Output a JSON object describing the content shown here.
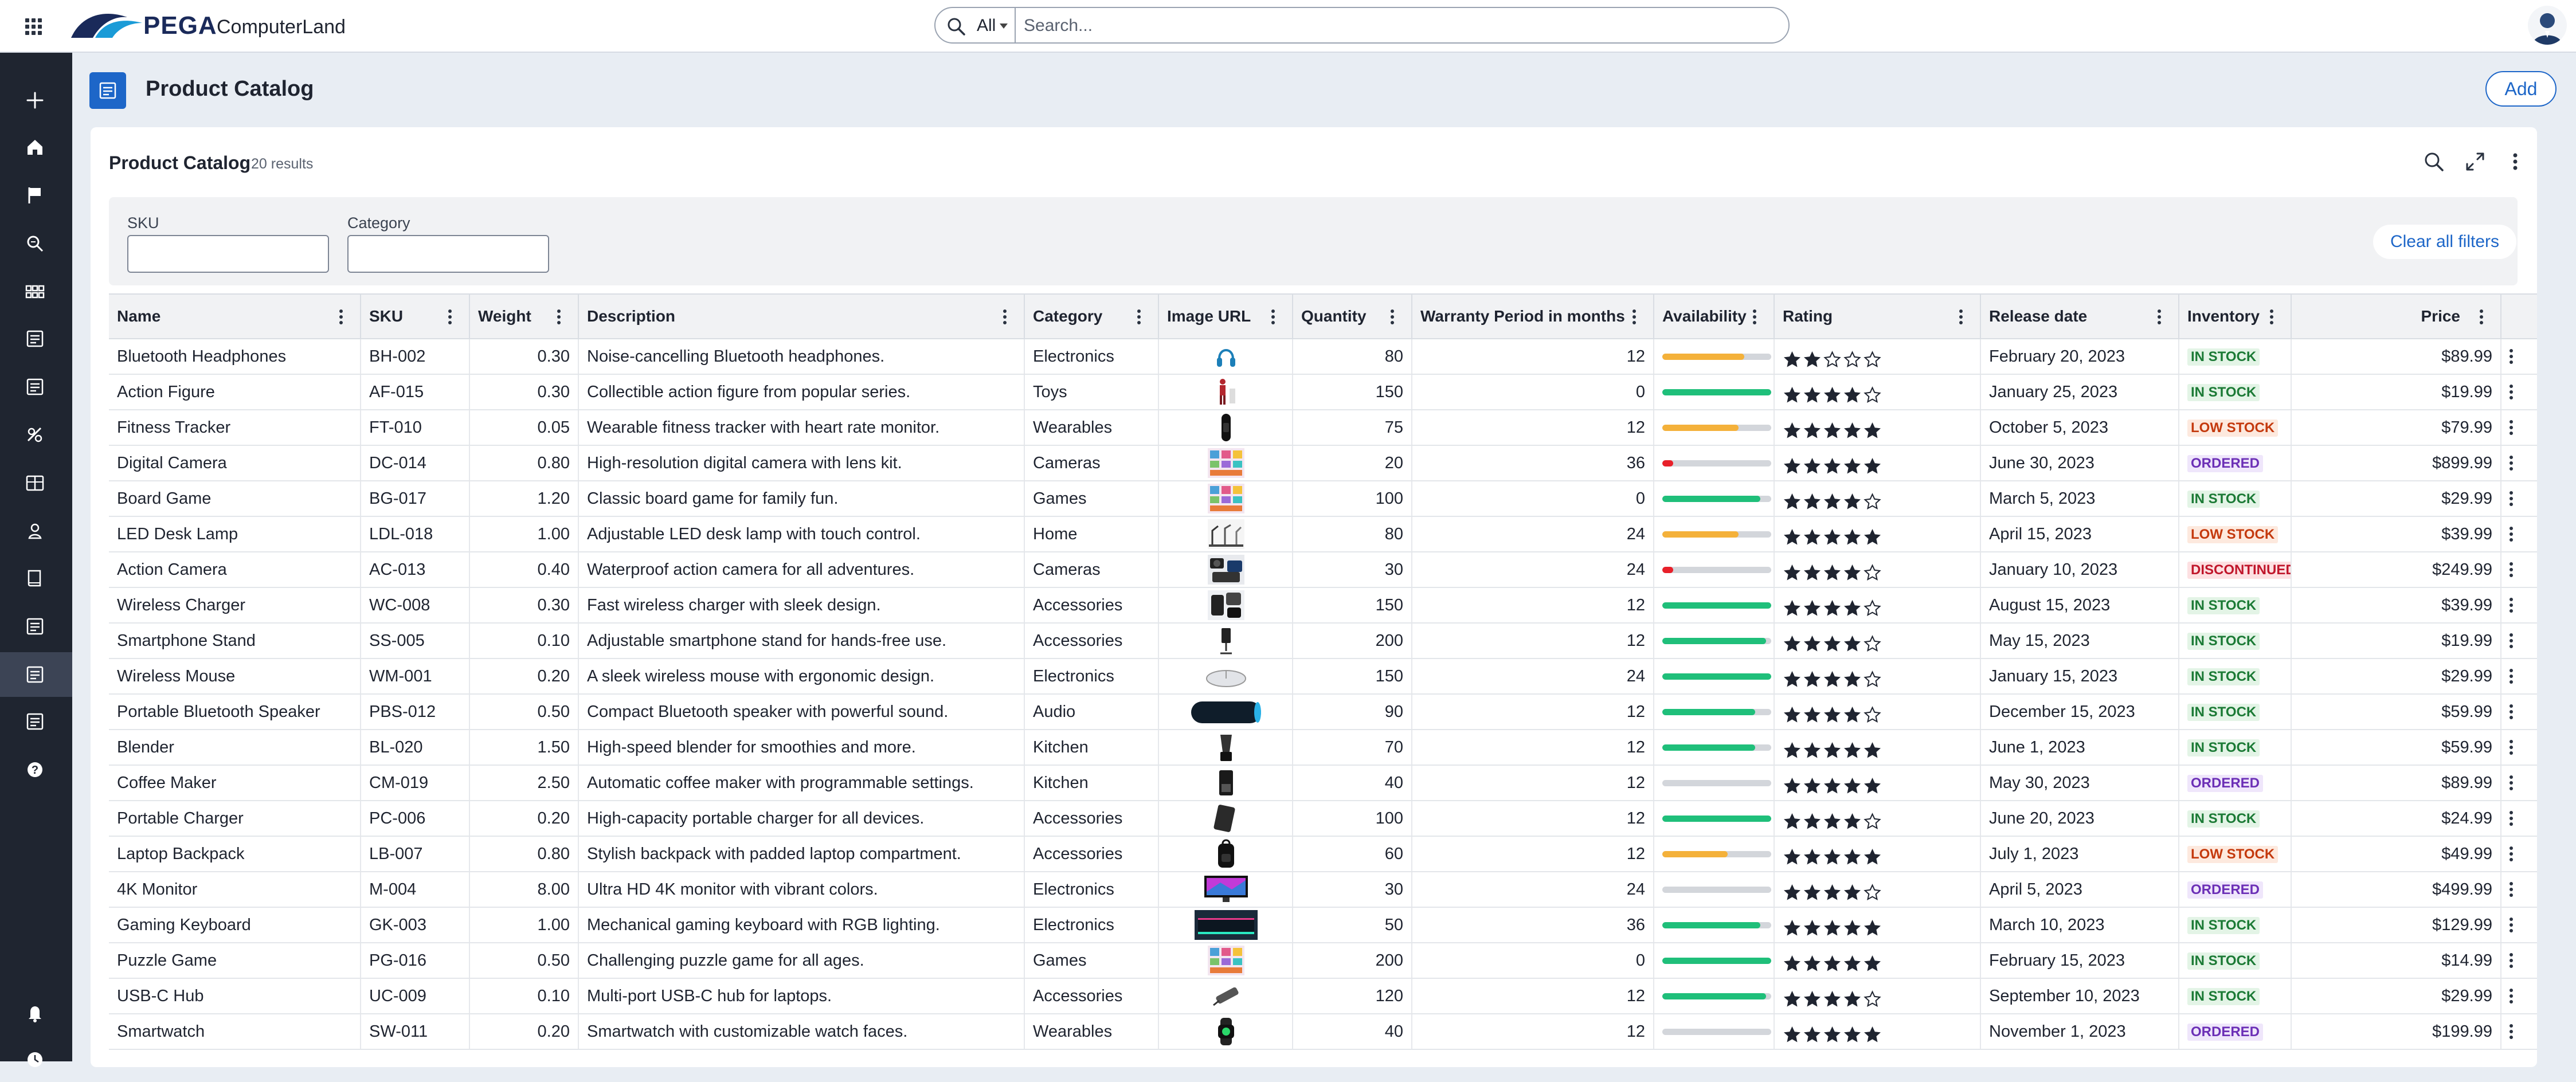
{
  "header": {
    "brand": "PEGA",
    "app_name": "ComputerLand",
    "search_scope": "All",
    "search_placeholder": "Search..."
  },
  "nav": {
    "items": [
      "add-icon",
      "home-icon",
      "flag-icon",
      "search-detail-icon",
      "apps-icon",
      "report-icon",
      "report-icon",
      "campaign-icon",
      "layout-icon",
      "tools-icon",
      "book-icon",
      "report-icon",
      "product-catalog-icon",
      "report-icon",
      "help-icon",
      "bell-icon",
      "clock-icon"
    ],
    "active_index": 12
  },
  "page": {
    "title": "Product Catalog",
    "add_label": "Add"
  },
  "list": {
    "title": "Product Catalog",
    "count": "20 results",
    "filters": {
      "sku_label": "SKU",
      "category_label": "Category",
      "clear_label": "Clear all filters"
    }
  },
  "columns": [
    "Name",
    "SKU",
    "Weight",
    "Description",
    "Category",
    "Image URL",
    "Quantity",
    "Warranty Period in months",
    "Availability",
    "Rating",
    "Release date",
    "Inventory Status",
    "Price"
  ],
  "status_colors": {
    "IN STOCK": {
      "fg": "#1b7a35",
      "bg": "#e3f4e6"
    },
    "LOW STOCK": {
      "fg": "#c4390d",
      "bg": "#fde9de"
    },
    "ORDERED": {
      "fg": "#6b2fb6",
      "bg": "#efe6fb"
    },
    "DISCONTINUED": {
      "fg": "#c0162b",
      "bg": "#fde0e2"
    }
  },
  "rows": [
    {
      "name": "Bluetooth Headphones",
      "sku": "BH-002",
      "weight": "0.30",
      "description": "Noise-cancelling Bluetooth headphones.",
      "category": "Electronics",
      "image": "headphones",
      "quantity": "80",
      "warranty": "12",
      "availability": 0.75,
      "availability_color": "#f4b13a",
      "rating": 2,
      "release": "February 20, 2023",
      "status": "IN STOCK",
      "price": "$89.99"
    },
    {
      "name": "Action Figure",
      "sku": "AF-015",
      "weight": "0.30",
      "description": "Collectible action figure from popular series.",
      "category": "Toys",
      "image": "figure",
      "quantity": "150",
      "warranty": "0",
      "availability": 1.0,
      "availability_color": "#1fbf7a",
      "rating": 4,
      "release": "January 25, 2023",
      "status": "IN STOCK",
      "price": "$19.99"
    },
    {
      "name": "Fitness Tracker",
      "sku": "FT-010",
      "weight": "0.05",
      "description": "Wearable fitness tracker with heart rate monitor.",
      "category": "Wearables",
      "image": "tracker",
      "quantity": "75",
      "warranty": "12",
      "availability": 0.7,
      "availability_color": "#f4b13a",
      "rating": 5,
      "release": "October 5, 2023",
      "status": "LOW STOCK",
      "price": "$79.99"
    },
    {
      "name": "Digital Camera",
      "sku": "DC-014",
      "weight": "0.80",
      "description": "High-resolution digital camera with lens kit.",
      "category": "Cameras",
      "image": "collage",
      "quantity": "20",
      "warranty": "36",
      "availability": 0.1,
      "availability_color": "#e8202a",
      "rating": 5,
      "release": "June 30, 2023",
      "status": "ORDERED",
      "price": "$899.99"
    },
    {
      "name": "Board Game",
      "sku": "BG-017",
      "weight": "1.20",
      "description": "Classic board game for family fun.",
      "category": "Games",
      "image": "collage",
      "quantity": "100",
      "warranty": "0",
      "availability": 0.9,
      "availability_color": "#1fbf7a",
      "rating": 4,
      "release": "March 5, 2023",
      "status": "IN STOCK",
      "price": "$29.99"
    },
    {
      "name": "LED Desk Lamp",
      "sku": "LDL-018",
      "weight": "1.00",
      "description": "Adjustable LED desk lamp with touch control.",
      "category": "Home",
      "image": "lamps",
      "quantity": "80",
      "warranty": "24",
      "availability": 0.7,
      "availability_color": "#f4b13a",
      "rating": 5,
      "release": "April 15, 2023",
      "status": "LOW STOCK",
      "price": "$39.99"
    },
    {
      "name": "Action Camera",
      "sku": "AC-013",
      "weight": "0.40",
      "description": "Waterproof action camera for all adventures.",
      "category": "Cameras",
      "image": "cameras",
      "quantity": "30",
      "warranty": "24",
      "availability": 0.1,
      "availability_color": "#e8202a",
      "rating": 4,
      "release": "January 10, 2023",
      "status": "DISCONTINUED",
      "price": "$249.99"
    },
    {
      "name": "Wireless Charger",
      "sku": "WC-008",
      "weight": "0.30",
      "description": "Fast wireless charger with sleek design.",
      "category": "Accessories",
      "image": "chargers",
      "quantity": "150",
      "warranty": "12",
      "availability": 1.0,
      "availability_color": "#1fbf7a",
      "rating": 4,
      "release": "August 15, 2023",
      "status": "IN STOCK",
      "price": "$39.99"
    },
    {
      "name": "Smartphone Stand",
      "sku": "SS-005",
      "weight": "0.10",
      "description": "Adjustable smartphone stand for hands-free use.",
      "category": "Accessories",
      "image": "stand",
      "quantity": "200",
      "warranty": "12",
      "availability": 0.95,
      "availability_color": "#1fbf7a",
      "rating": 4,
      "release": "May 15, 2023",
      "status": "IN STOCK",
      "price": "$19.99"
    },
    {
      "name": "Wireless Mouse",
      "sku": "WM-001",
      "weight": "0.20",
      "description": "A sleek wireless mouse with ergonomic design.",
      "category": "Electronics",
      "image": "mouse",
      "quantity": "150",
      "warranty": "24",
      "availability": 1.0,
      "availability_color": "#1fbf7a",
      "rating": 4,
      "release": "January 15, 2023",
      "status": "IN STOCK",
      "price": "$29.99"
    },
    {
      "name": "Portable Bluetooth Speaker",
      "sku": "PBS-012",
      "weight": "0.50",
      "description": "Compact Bluetooth speaker with powerful sound.",
      "category": "Audio",
      "image": "speaker",
      "quantity": "90",
      "warranty": "12",
      "availability": 0.85,
      "availability_color": "#1fbf7a",
      "rating": 4,
      "release": "December 15, 2023",
      "status": "IN STOCK",
      "price": "$59.99"
    },
    {
      "name": "Blender",
      "sku": "BL-020",
      "weight": "1.50",
      "description": "High-speed blender for smoothies and more.",
      "category": "Kitchen",
      "image": "blender",
      "quantity": "70",
      "warranty": "12",
      "availability": 0.85,
      "availability_color": "#1fbf7a",
      "rating": 5,
      "release": "June 1, 2023",
      "status": "IN STOCK",
      "price": "$59.99"
    },
    {
      "name": "Coffee Maker",
      "sku": "CM-019",
      "weight": "2.50",
      "description": "Automatic coffee maker with programmable settings.",
      "category": "Kitchen",
      "image": "coffee",
      "quantity": "40",
      "warranty": "12",
      "availability": 0.0,
      "availability_color": "#1fbf7a",
      "rating": 5,
      "release": "May 30, 2023",
      "status": "ORDERED",
      "price": "$89.99"
    },
    {
      "name": "Portable Charger",
      "sku": "PC-006",
      "weight": "0.20",
      "description": "High-capacity portable charger for all devices.",
      "category": "Accessories",
      "image": "powerbank",
      "quantity": "100",
      "warranty": "12",
      "availability": 1.0,
      "availability_color": "#1fbf7a",
      "rating": 4,
      "release": "June 20, 2023",
      "status": "IN STOCK",
      "price": "$24.99"
    },
    {
      "name": "Laptop Backpack",
      "sku": "LB-007",
      "weight": "0.80",
      "description": "Stylish backpack with padded laptop compartment.",
      "category": "Accessories",
      "image": "backpack",
      "quantity": "60",
      "warranty": "12",
      "availability": 0.6,
      "availability_color": "#f4b13a",
      "rating": 5,
      "release": "July 1, 2023",
      "status": "LOW STOCK",
      "price": "$49.99"
    },
    {
      "name": "4K Monitor",
      "sku": "M-004",
      "weight": "8.00",
      "description": "Ultra HD 4K monitor with vibrant colors.",
      "category": "Electronics",
      "image": "monitor",
      "quantity": "30",
      "warranty": "24",
      "availability": 0.0,
      "availability_color": "#1fbf7a",
      "rating": 4,
      "release": "April 5, 2023",
      "status": "ORDERED",
      "price": "$499.99"
    },
    {
      "name": "Gaming Keyboard",
      "sku": "GK-003",
      "weight": "1.00",
      "description": "Mechanical gaming keyboard with RGB lighting.",
      "category": "Electronics",
      "image": "keyboard",
      "quantity": "50",
      "warranty": "36",
      "availability": 0.9,
      "availability_color": "#1fbf7a",
      "rating": 5,
      "release": "March 10, 2023",
      "status": "IN STOCK",
      "price": "$129.99"
    },
    {
      "name": "Puzzle Game",
      "sku": "PG-016",
      "weight": "0.50",
      "description": "Challenging puzzle game for all ages.",
      "category": "Games",
      "image": "collage",
      "quantity": "200",
      "warranty": "0",
      "availability": 1.0,
      "availability_color": "#1fbf7a",
      "rating": 5,
      "release": "February 15, 2023",
      "status": "IN STOCK",
      "price": "$14.99"
    },
    {
      "name": "USB-C Hub",
      "sku": "UC-009",
      "weight": "0.10",
      "description": "Multi-port USB-C hub for laptops.",
      "category": "Accessories",
      "image": "hub",
      "quantity": "120",
      "warranty": "12",
      "availability": 0.95,
      "availability_color": "#1fbf7a",
      "rating": 4,
      "release": "September 10, 2023",
      "status": "IN STOCK",
      "price": "$29.99"
    },
    {
      "name": "Smartwatch",
      "sku": "SW-011",
      "weight": "0.20",
      "description": "Smartwatch with customizable watch faces.",
      "category": "Wearables",
      "image": "watch",
      "quantity": "40",
      "warranty": "12",
      "availability": 0.0,
      "availability_color": "#1fbf7a",
      "rating": 5,
      "release": "November 1, 2023",
      "status": "ORDERED",
      "price": "$199.99"
    }
  ]
}
